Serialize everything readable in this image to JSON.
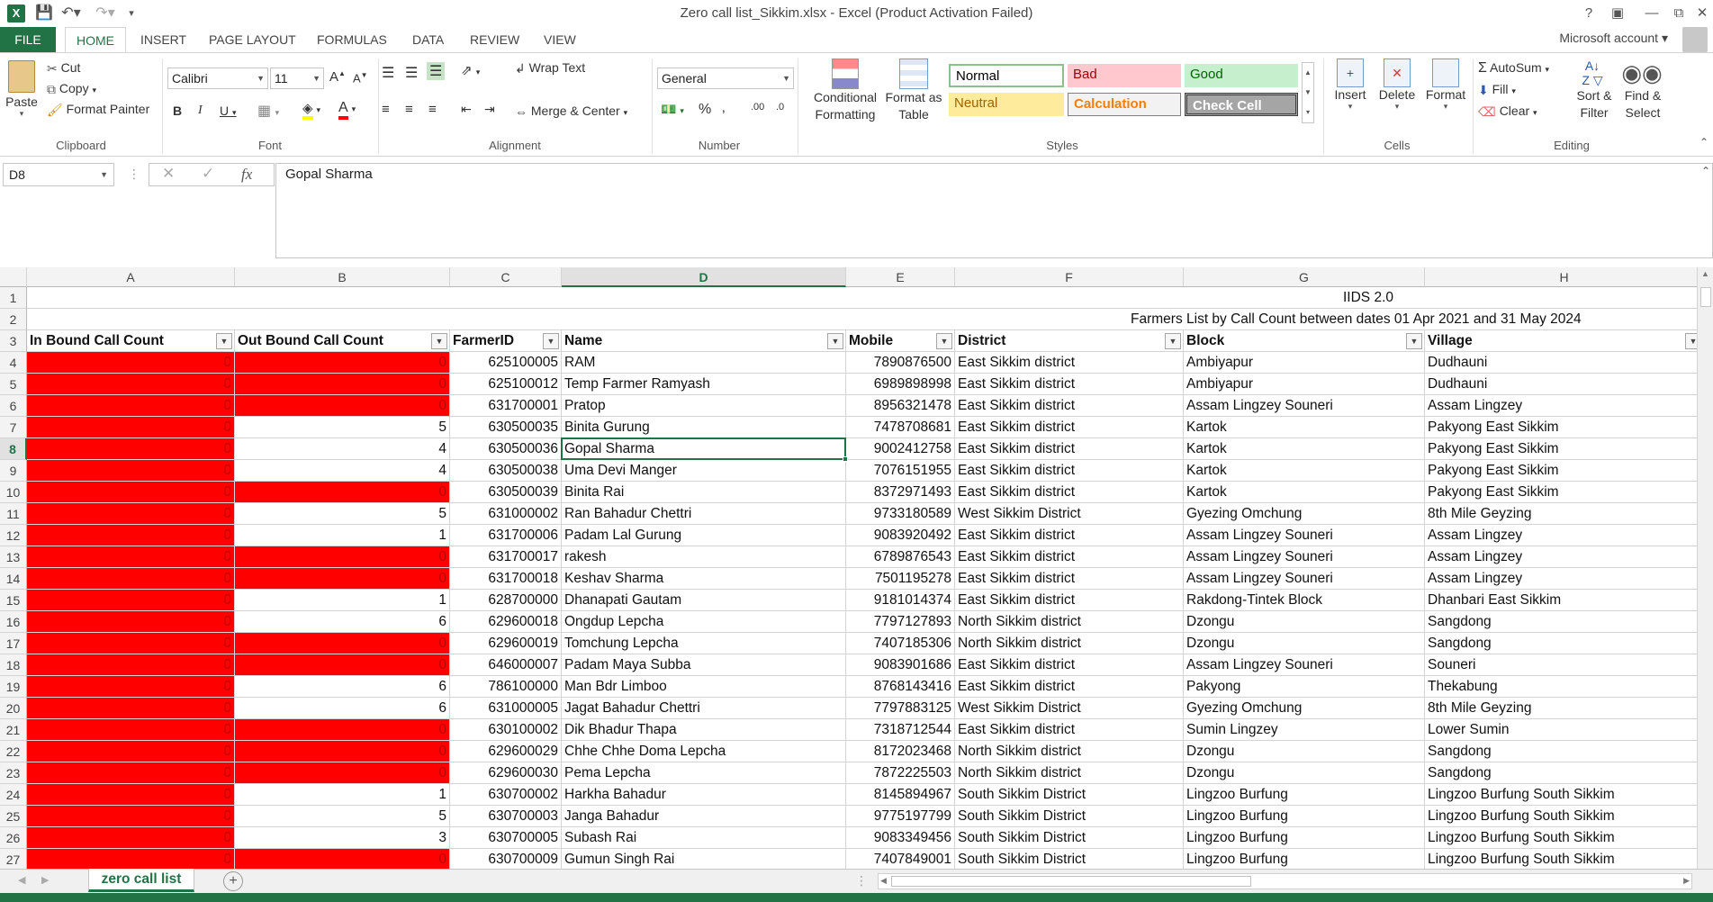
{
  "window": {
    "title": "Zero call list_Sikkim.xlsx - Excel (Product Activation Failed)",
    "help": "?",
    "account": "Microsoft account"
  },
  "tabs": [
    {
      "label": "FILE"
    },
    {
      "label": "HOME"
    },
    {
      "label": "INSERT"
    },
    {
      "label": "PAGE LAYOUT"
    },
    {
      "label": "FORMULAS"
    },
    {
      "label": "DATA"
    },
    {
      "label": "REVIEW"
    },
    {
      "label": "VIEW"
    }
  ],
  "ribbon": {
    "clipboard": {
      "paste": "Paste",
      "cut": "Cut",
      "copy": "Copy",
      "format_painter": "Format Painter",
      "label": "Clipboard"
    },
    "font": {
      "name": "Calibri",
      "size": "11",
      "label": "Font"
    },
    "alignment": {
      "wrap": "Wrap Text",
      "merge": "Merge & Center",
      "label": "Alignment"
    },
    "number": {
      "format": "General",
      "label": "Number"
    },
    "styles": {
      "conditional": "Conditional Formatting",
      "format_table": "Format as Table",
      "normal": "Normal",
      "bad": "Bad",
      "good": "Good",
      "neutral": "Neutral",
      "calculation": "Calculation",
      "check": "Check Cell",
      "label": "Styles"
    },
    "cells": {
      "insert": "Insert",
      "delete": "Delete",
      "format": "Format",
      "label": "Cells"
    },
    "editing": {
      "autosum": "AutoSum",
      "fill": "Fill",
      "clear": "Clear",
      "sort": "Sort & Filter",
      "find": "Find & Select",
      "label": "Editing"
    }
  },
  "formula_bar": {
    "name_box": "D8",
    "fx": "fx",
    "value": "Gopal Sharma"
  },
  "columns": [
    "A",
    "B",
    "C",
    "D",
    "E",
    "F",
    "G",
    "H"
  ],
  "sheet": {
    "title_row": "IIDS 2.0",
    "subtitle_row": "Farmers List by Call Count  between dates 01 Apr 2021 and 31 May 2024",
    "headers": [
      "In Bound Call Count",
      "Out Bound Call Count",
      "FarmerID",
      "Name",
      "Mobile",
      "District",
      "Block",
      "Village"
    ],
    "rows": [
      {
        "n": "4",
        "a": "0",
        "b": "0",
        "c": "625100005",
        "d": "RAM",
        "e": "7890876500",
        "f": "East Sikkim district",
        "g": "Ambiyapur",
        "h": "Dudhauni"
      },
      {
        "n": "5",
        "a": "0",
        "b": "0",
        "c": "625100012",
        "d": "Temp Farmer Ramyash",
        "e": "6989898998",
        "f": "East Sikkim district",
        "g": "Ambiyapur",
        "h": "Dudhauni"
      },
      {
        "n": "6",
        "a": "0",
        "b": "0",
        "c": "631700001",
        "d": "Pratop",
        "e": "8956321478",
        "f": "East Sikkim district",
        "g": "Assam Lingzey Souneri",
        "h": "Assam Lingzey"
      },
      {
        "n": "7",
        "a": "0",
        "b": "5",
        "c": "630500035",
        "d": "Binita Gurung",
        "e": "7478708681",
        "f": "East Sikkim district",
        "g": "Kartok",
        "h": "Pakyong East Sikkim"
      },
      {
        "n": "8",
        "a": "0",
        "b": "4",
        "c": "630500036",
        "d": "Gopal Sharma",
        "e": "9002412758",
        "f": "East Sikkim district",
        "g": "Kartok",
        "h": "Pakyong East Sikkim"
      },
      {
        "n": "9",
        "a": "0",
        "b": "4",
        "c": "630500038",
        "d": "Uma Devi Manger",
        "e": "7076151955",
        "f": "East Sikkim district",
        "g": "Kartok",
        "h": "Pakyong East Sikkim"
      },
      {
        "n": "10",
        "a": "0",
        "b": "0",
        "c": "630500039",
        "d": "Binita Rai",
        "e": "8372971493",
        "f": "East Sikkim district",
        "g": "Kartok",
        "h": "Pakyong East Sikkim"
      },
      {
        "n": "11",
        "a": "0",
        "b": "5",
        "c": "631000002",
        "d": "Ran Bahadur Chettri",
        "e": "9733180589",
        "f": "West Sikkim District",
        "g": "Gyezing Omchung",
        "h": "8th Mile Geyzing"
      },
      {
        "n": "12",
        "a": "0",
        "b": "1",
        "c": "631700006",
        "d": "Padam Lal Gurung",
        "e": "9083920492",
        "f": "East Sikkim district",
        "g": "Assam Lingzey Souneri",
        "h": "Assam Lingzey"
      },
      {
        "n": "13",
        "a": "0",
        "b": "0",
        "c": "631700017",
        "d": "rakesh",
        "e": "6789876543",
        "f": "East Sikkim district",
        "g": "Assam Lingzey Souneri",
        "h": "Assam Lingzey"
      },
      {
        "n": "14",
        "a": "0",
        "b": "0",
        "c": "631700018",
        "d": "Keshav Sharma",
        "e": "7501195278",
        "f": "East Sikkim district",
        "g": "Assam Lingzey Souneri",
        "h": "Assam Lingzey"
      },
      {
        "n": "15",
        "a": "0",
        "b": "1",
        "c": "628700000",
        "d": "Dhanapati Gautam",
        "e": "9181014374",
        "f": "East Sikkim district",
        "g": "Rakdong-Tintek Block",
        "h": "Dhanbari East Sikkim"
      },
      {
        "n": "16",
        "a": "0",
        "b": "6",
        "c": "629600018",
        "d": "Ongdup Lepcha",
        "e": "7797127893",
        "f": "North Sikkim district",
        "g": "Dzongu",
        "h": "Sangdong"
      },
      {
        "n": "17",
        "a": "0",
        "b": "0",
        "c": "629600019",
        "d": "Tomchung Lepcha",
        "e": "7407185306",
        "f": "North Sikkim district",
        "g": "Dzongu",
        "h": "Sangdong"
      },
      {
        "n": "18",
        "a": "0",
        "b": "0",
        "c": "646000007",
        "d": "Padam Maya Subba",
        "e": "9083901686",
        "f": "East Sikkim district",
        "g": "Assam Lingzey Souneri",
        "h": "Souneri"
      },
      {
        "n": "19",
        "a": "0",
        "b": "6",
        "c": "786100000",
        "d": "Man Bdr Limboo",
        "e": "8768143416",
        "f": "East Sikkim district",
        "g": "Pakyong",
        "h": "Thekabung"
      },
      {
        "n": "20",
        "a": "0",
        "b": "6",
        "c": "631000005",
        "d": "Jagat Bahadur Chettri",
        "e": "7797883125",
        "f": "West Sikkim District",
        "g": "Gyezing Omchung",
        "h": "8th Mile Geyzing"
      },
      {
        "n": "21",
        "a": "0",
        "b": "0",
        "c": "630100002",
        "d": "Dik Bhadur Thapa",
        "e": "7318712544",
        "f": "East Sikkim district",
        "g": "Sumin Lingzey",
        "h": "Lower Sumin"
      },
      {
        "n": "22",
        "a": "0",
        "b": "0",
        "c": "629600029",
        "d": "Chhe Chhe Doma Lepcha",
        "e": "8172023468",
        "f": "North Sikkim district",
        "g": "Dzongu",
        "h": "Sangdong"
      },
      {
        "n": "23",
        "a": "0",
        "b": "0",
        "c": "629600030",
        "d": "Pema Lepcha",
        "e": "7872225503",
        "f": "North Sikkim district",
        "g": "Dzongu",
        "h": "Sangdong"
      },
      {
        "n": "24",
        "a": "0",
        "b": "1",
        "c": "630700002",
        "d": "Harkha Bahadur",
        "e": "8145894967",
        "f": "South Sikkim District",
        "g": "Lingzoo Burfung",
        "h": "Lingzoo Burfung South Sikkim"
      },
      {
        "n": "25",
        "a": "0",
        "b": "5",
        "c": "630700003",
        "d": "Janga Bahadur",
        "e": "9775197799",
        "f": "South Sikkim District",
        "g": "Lingzoo Burfung",
        "h": "Lingzoo Burfung South Sikkim"
      },
      {
        "n": "26",
        "a": "0",
        "b": "3",
        "c": "630700005",
        "d": "Subash Rai",
        "e": "9083349456",
        "f": "South Sikkim District",
        "g": "Lingzoo Burfung",
        "h": "Lingzoo Burfung South Sikkim"
      },
      {
        "n": "27",
        "a": "0",
        "b": "0",
        "c": "630700009",
        "d": "Gumun Singh Rai",
        "e": "7407849001",
        "f": "South Sikkim District",
        "g": "Lingzoo Burfung",
        "h": "Lingzoo Burfung South Sikkim"
      }
    ]
  },
  "sheet_tabs": [
    {
      "label": "zero call list"
    }
  ],
  "colors": {
    "accent": "#217346",
    "red_fill": "#ff0000",
    "zero_text": "#c00000"
  }
}
